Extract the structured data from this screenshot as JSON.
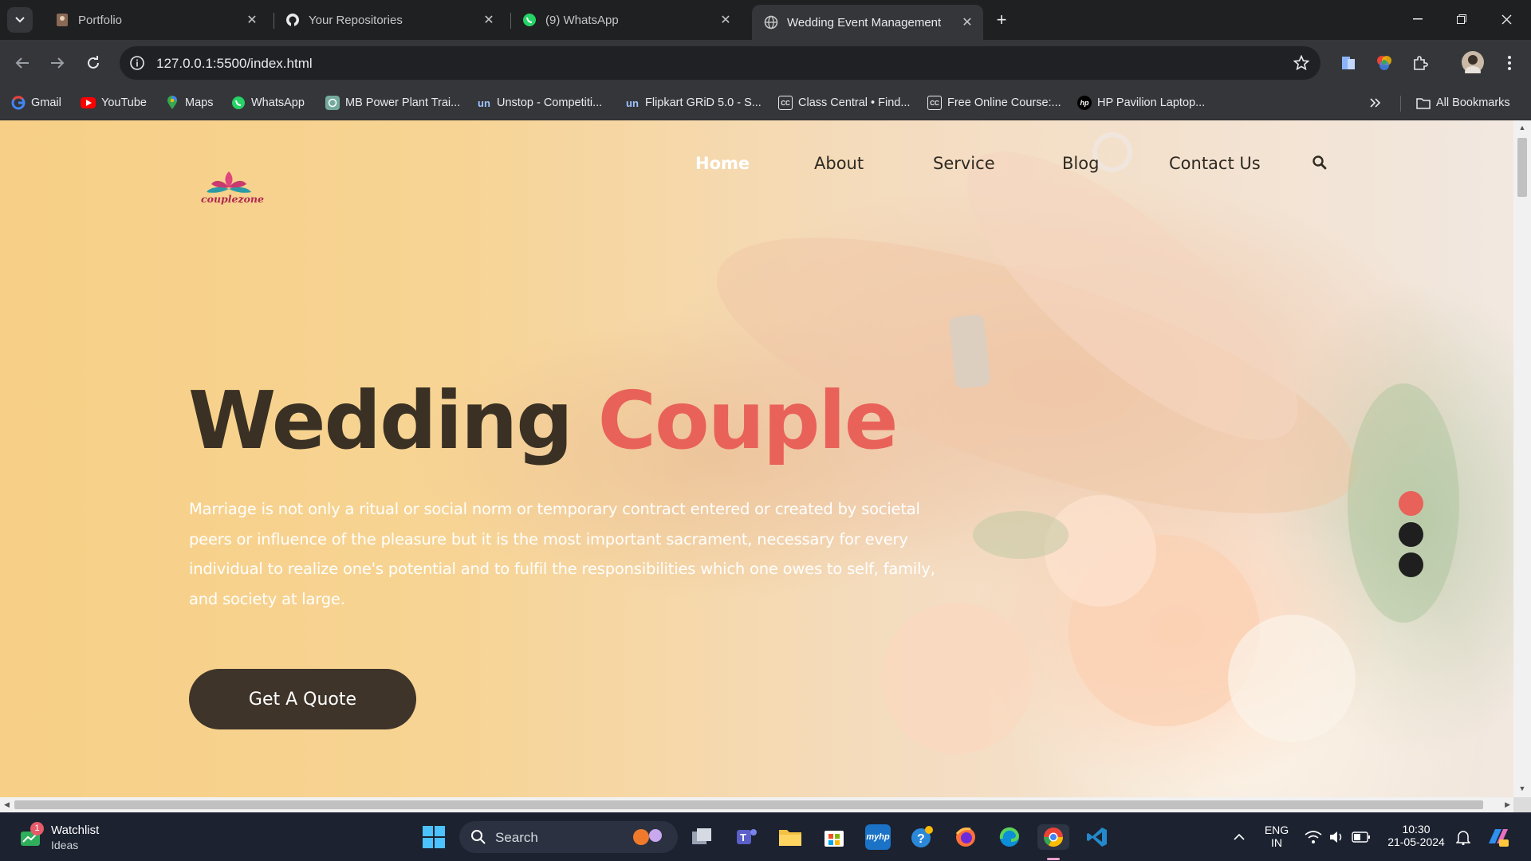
{
  "browser": {
    "tabs": [
      {
        "title": "Portfolio",
        "icon": "portfolio-favicon"
      },
      {
        "title": "Your Repositories",
        "icon": "github-icon"
      },
      {
        "title": "(9) WhatsApp",
        "icon": "whatsapp-icon"
      },
      {
        "title": "Wedding Event Management",
        "icon": "globe-icon",
        "active": true
      }
    ],
    "url": "127.0.0.1:5500/index.html",
    "bookmarks": [
      {
        "label": "Gmail",
        "icon": "google-icon"
      },
      {
        "label": "YouTube",
        "icon": "youtube-icon"
      },
      {
        "label": "Maps",
        "icon": "maps-pin-icon"
      },
      {
        "label": "WhatsApp",
        "icon": "whatsapp-icon"
      },
      {
        "label": "MB Power Plant Trai...",
        "icon": "chatgpt-icon"
      },
      {
        "label": "Unstop - Competiti...",
        "icon": "unstop-icon"
      },
      {
        "label": "Flipkart GRiD 5.0 - S...",
        "icon": "unstop-icon"
      },
      {
        "label": "Class Central • Find...",
        "icon": "classcentral-icon"
      },
      {
        "label": "Free Online Course:...",
        "icon": "classcentral-icon"
      },
      {
        "label": "HP Pavilion Laptop...",
        "icon": "hp-icon"
      }
    ],
    "all_bookmarks": "All Bookmarks"
  },
  "site": {
    "logo_text": "couplezone",
    "nav": [
      "Home",
      "About",
      "Service",
      "Blog",
      "Contact Us"
    ],
    "active_nav": "Home",
    "hero": {
      "title_word1": "Wedding",
      "title_word2": "Couple",
      "description": "Marriage is not only a ritual or social norm or temporary contract entered or created by societal peers or influence of the pleasure but it is the most important sacrament, necessary for every individual to realize one's potential and to fulfil the responsibilities which one owes to self, family, and society at large.",
      "cta": "Get A Quote"
    },
    "slider_dots": 3,
    "active_dot": 0
  },
  "taskbar": {
    "widget_title": "Watchlist",
    "widget_sub": "Ideas",
    "widget_badge": "1",
    "search_label": "Search",
    "lang_top": "ENG",
    "lang_bottom": "IN",
    "time": "10:30",
    "date": "21-05-2024"
  },
  "colors": {
    "accent": "#e8625a",
    "dark_brown": "#3e3429",
    "chrome_bg": "#35363a"
  }
}
